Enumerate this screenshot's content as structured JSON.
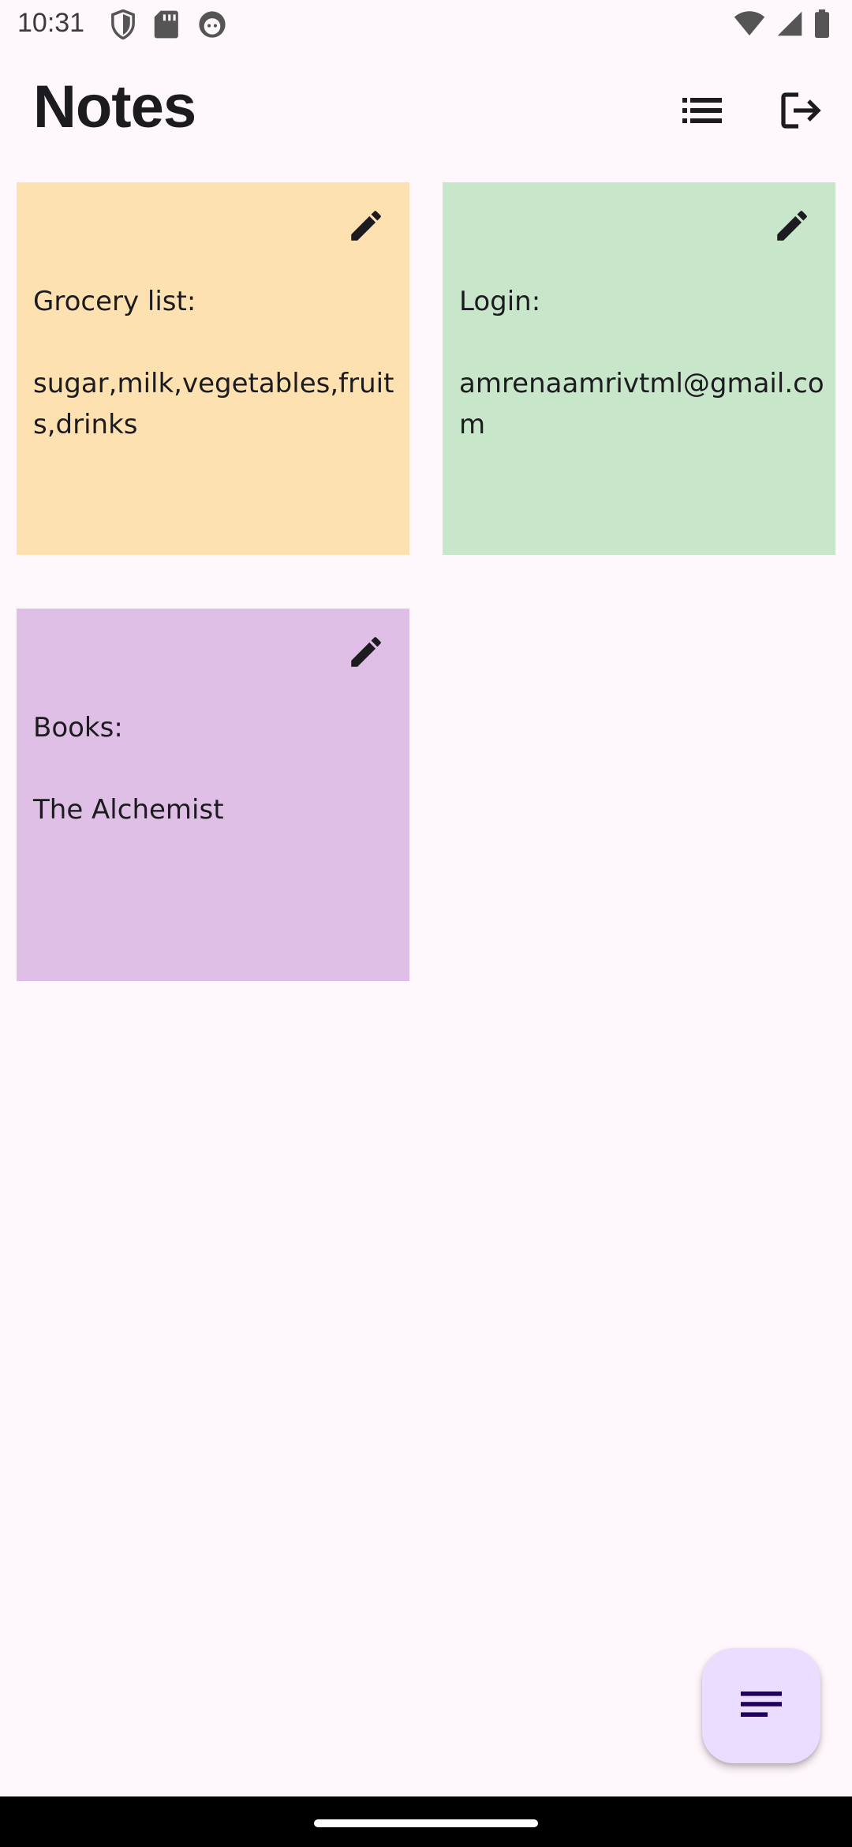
{
  "status_bar": {
    "time": "10:31",
    "left_icons": [
      "shield-icon",
      "sd-card-icon",
      "face-icon"
    ],
    "right_icons": [
      "wifi-icon",
      "signal-icon",
      "battery-icon"
    ]
  },
  "app_bar": {
    "title": "Notes",
    "actions": [
      "list-view-icon",
      "logout-icon"
    ]
  },
  "notes": [
    {
      "text": "Grocery list:\n\nsugar,milk,vegetables,fruits,drinks",
      "color": "#FDE1B1"
    },
    {
      "text": "Login:\n\namrenaamrivtml@gmail.com",
      "color": "#C8E6C9"
    },
    {
      "text": "Books:\n\nThe Alchemist",
      "color": "#E0BFE7"
    }
  ],
  "fab": {
    "icon": "sort-lines-icon",
    "color": "#EADDFF"
  },
  "colors": {
    "background": "#FEF7FC",
    "icon_dark": "#1c1b1f",
    "fab_icon": "#21005D"
  }
}
